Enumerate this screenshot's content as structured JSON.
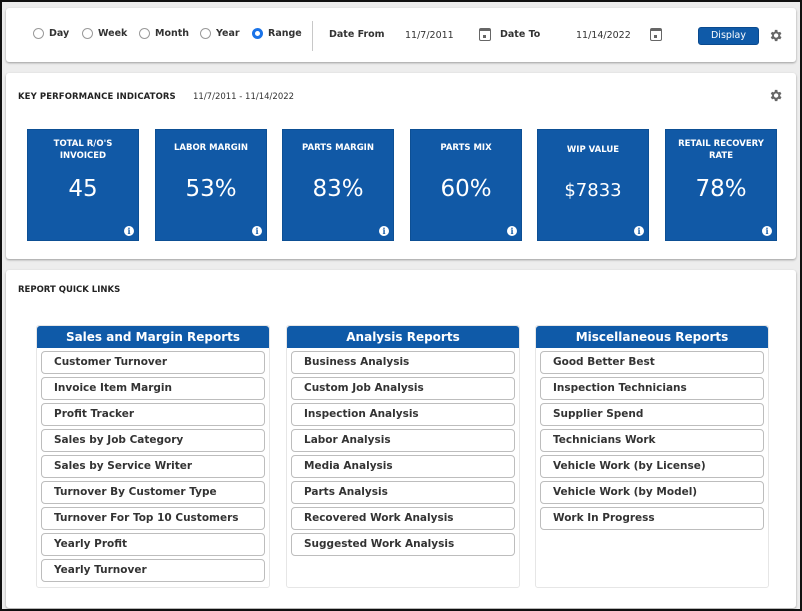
{
  "filter": {
    "periods": [
      {
        "label": "Day",
        "checked": false
      },
      {
        "label": "Week",
        "checked": false
      },
      {
        "label": "Month",
        "checked": false
      },
      {
        "label": "Year",
        "checked": false
      },
      {
        "label": "Range",
        "checked": true
      }
    ],
    "date_from_label": "Date From",
    "date_from_value": "11/7/2011",
    "date_to_label": "Date To",
    "date_to_value": "11/14/2022",
    "display_label": "Display",
    "icons": {
      "calendar": "calendar-icon",
      "settings": "gear-icon"
    }
  },
  "kpi": {
    "title": "KEY PERFORMANCE INDICATORS",
    "range": "11/7/2011 - 11/14/2022",
    "tiles": [
      {
        "label": "TOTAL R/O'S INVOICED",
        "value": "45"
      },
      {
        "label": "LABOR MARGIN",
        "value": "53%"
      },
      {
        "label": "PARTS MARGIN",
        "value": "83%"
      },
      {
        "label": "PARTS MIX",
        "value": "60%"
      },
      {
        "label": "WIP VALUE",
        "value": "$7833"
      },
      {
        "label": "RETAIL RECOVERY RATE",
        "value": "78%"
      }
    ],
    "info_glyph": "i"
  },
  "quick_links": {
    "title": "REPORT QUICK LINKS",
    "columns": [
      {
        "heading": "Sales and Margin Reports",
        "links": [
          "Customer Turnover",
          "Invoice Item Margin",
          "Profit Tracker",
          "Sales by Job Category",
          "Sales by Service Writer",
          "Turnover By Customer Type",
          "Turnover For Top 10 Customers",
          "Yearly Profit",
          "Yearly Turnover"
        ]
      },
      {
        "heading": "Analysis Reports",
        "links": [
          "Business Analysis",
          "Custom Job Analysis",
          "Inspection Analysis",
          "Labor Analysis",
          "Media Analysis",
          "Parts Analysis",
          "Recovered Work Analysis",
          "Suggested Work Analysis"
        ]
      },
      {
        "heading": "Miscellaneous Reports",
        "links": [
          "Good Better Best",
          "Inspection Technicians",
          "Supplier Spend",
          "Technicians Work",
          "Vehicle Work (by License)",
          "Vehicle Work (by Model)",
          "Work In Progress"
        ]
      }
    ]
  },
  "colors": {
    "accent": "#0f5aa8",
    "tile": "#1159a6",
    "radio_checked": "#1a73e8"
  }
}
